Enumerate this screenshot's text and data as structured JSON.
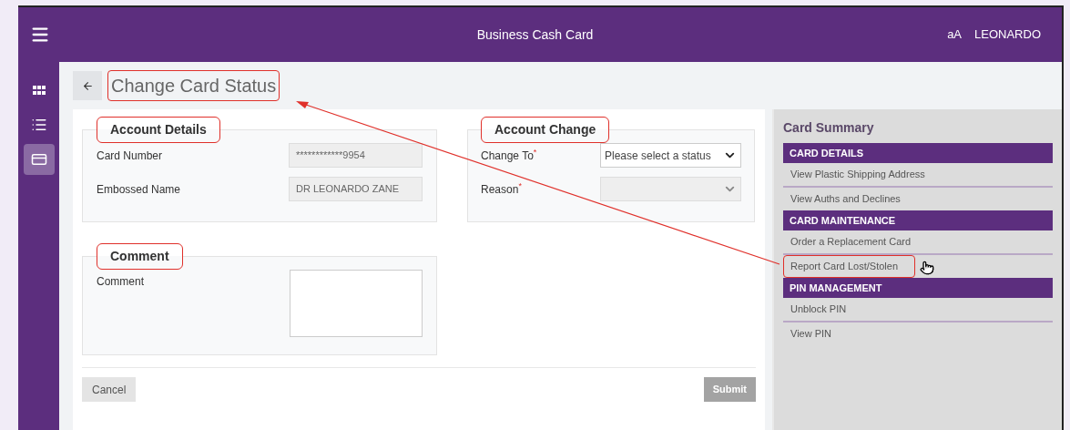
{
  "app_bar": {
    "title": "Business Cash Card",
    "font_toggle": "aA",
    "user": "LEONARDO"
  },
  "sidebar": {
    "items": [
      {
        "kind": "apps",
        "selected": false
      },
      {
        "kind": "list",
        "selected": false
      },
      {
        "kind": "card",
        "selected": true
      }
    ]
  },
  "page_title": {
    "text": "Change Card Status",
    "highlighted": true
  },
  "account_details": {
    "legend": "Account Details",
    "highlighted": true,
    "fields": [
      {
        "label": "Card Number",
        "value": "************9954",
        "disabled": true
      },
      {
        "label": "Embossed Name",
        "value": "DR LEONARDO ZANE",
        "disabled": true
      }
    ]
  },
  "account_change": {
    "legend": "Account Change",
    "highlighted": true,
    "fields": [
      {
        "label": "Change To$^{*}$",
        "value": "Please select a status",
        "disabled": false
      },
      {
        "label": "Reason$^{*}$",
        "disabled": true
      }
    ]
  },
  "comment": {
    "legend": "Comment",
    "highlighted": true,
    "field": {
      "label": "Comment"
    }
  },
  "buttons": {
    "cancel": {
      "label": "Cancel"
    },
    "submit": {
      "label": "Submit",
      "disabled": true
    }
  },
  "card_summary": {
    "title": "Card Summary",
    "groups": [
      {
        "title": "CARD DETAILS",
        "items": [
          {
            "label": "View Plastic Shipping Address",
            "highlighted": false,
            "hovered": false
          },
          {
            "label": "View Auths and Declines",
            "highlighted": false,
            "hovered": false
          }
        ]
      },
      {
        "title": "CARD MAINTENANCE",
        "items": [
          {
            "label": "Order a Replacement Card",
            "highlighted": false,
            "hovered": false
          },
          {
            "label": "Report Card Lost/Stolen",
            "highlighted": true,
            "hovered": true
          }
        ]
      },
      {
        "title": "PIN MANAGEMENT",
        "items": [
          {
            "label": "Unblock PIN",
            "highlighted": false,
            "hovered": false
          },
          {
            "label": "View PIN",
            "highlighted": false,
            "hovered": false
          }
        ]
      }
    ]
  },
  "annotation_arrow": true
}
